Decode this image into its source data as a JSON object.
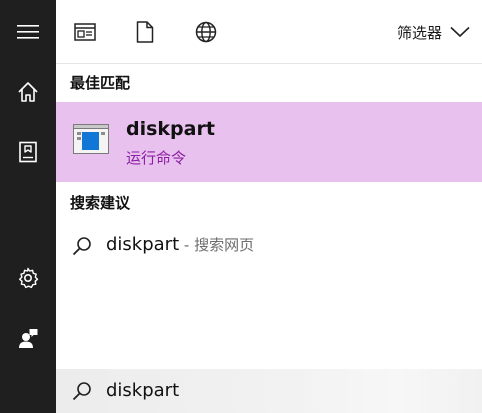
{
  "sidebar": {
    "icons": [
      "hamburger-menu-icon",
      "home-icon",
      "notebook-icon",
      "settings-icon",
      "feedback-icon"
    ]
  },
  "topbar": {
    "icons": [
      "app-window-icon",
      "document-icon",
      "globe-icon"
    ],
    "filter_label": "筛选器"
  },
  "best_match": {
    "heading": "最佳匹配",
    "name": "diskpart",
    "type": "运行命令",
    "highlight_color": "#e9c1ef",
    "type_color": "#8b1fa3"
  },
  "suggestions": {
    "heading": "搜索建议",
    "items": [
      {
        "text": "diskpart",
        "sub": " - 搜索网页"
      }
    ]
  },
  "search": {
    "value": "diskpart"
  }
}
